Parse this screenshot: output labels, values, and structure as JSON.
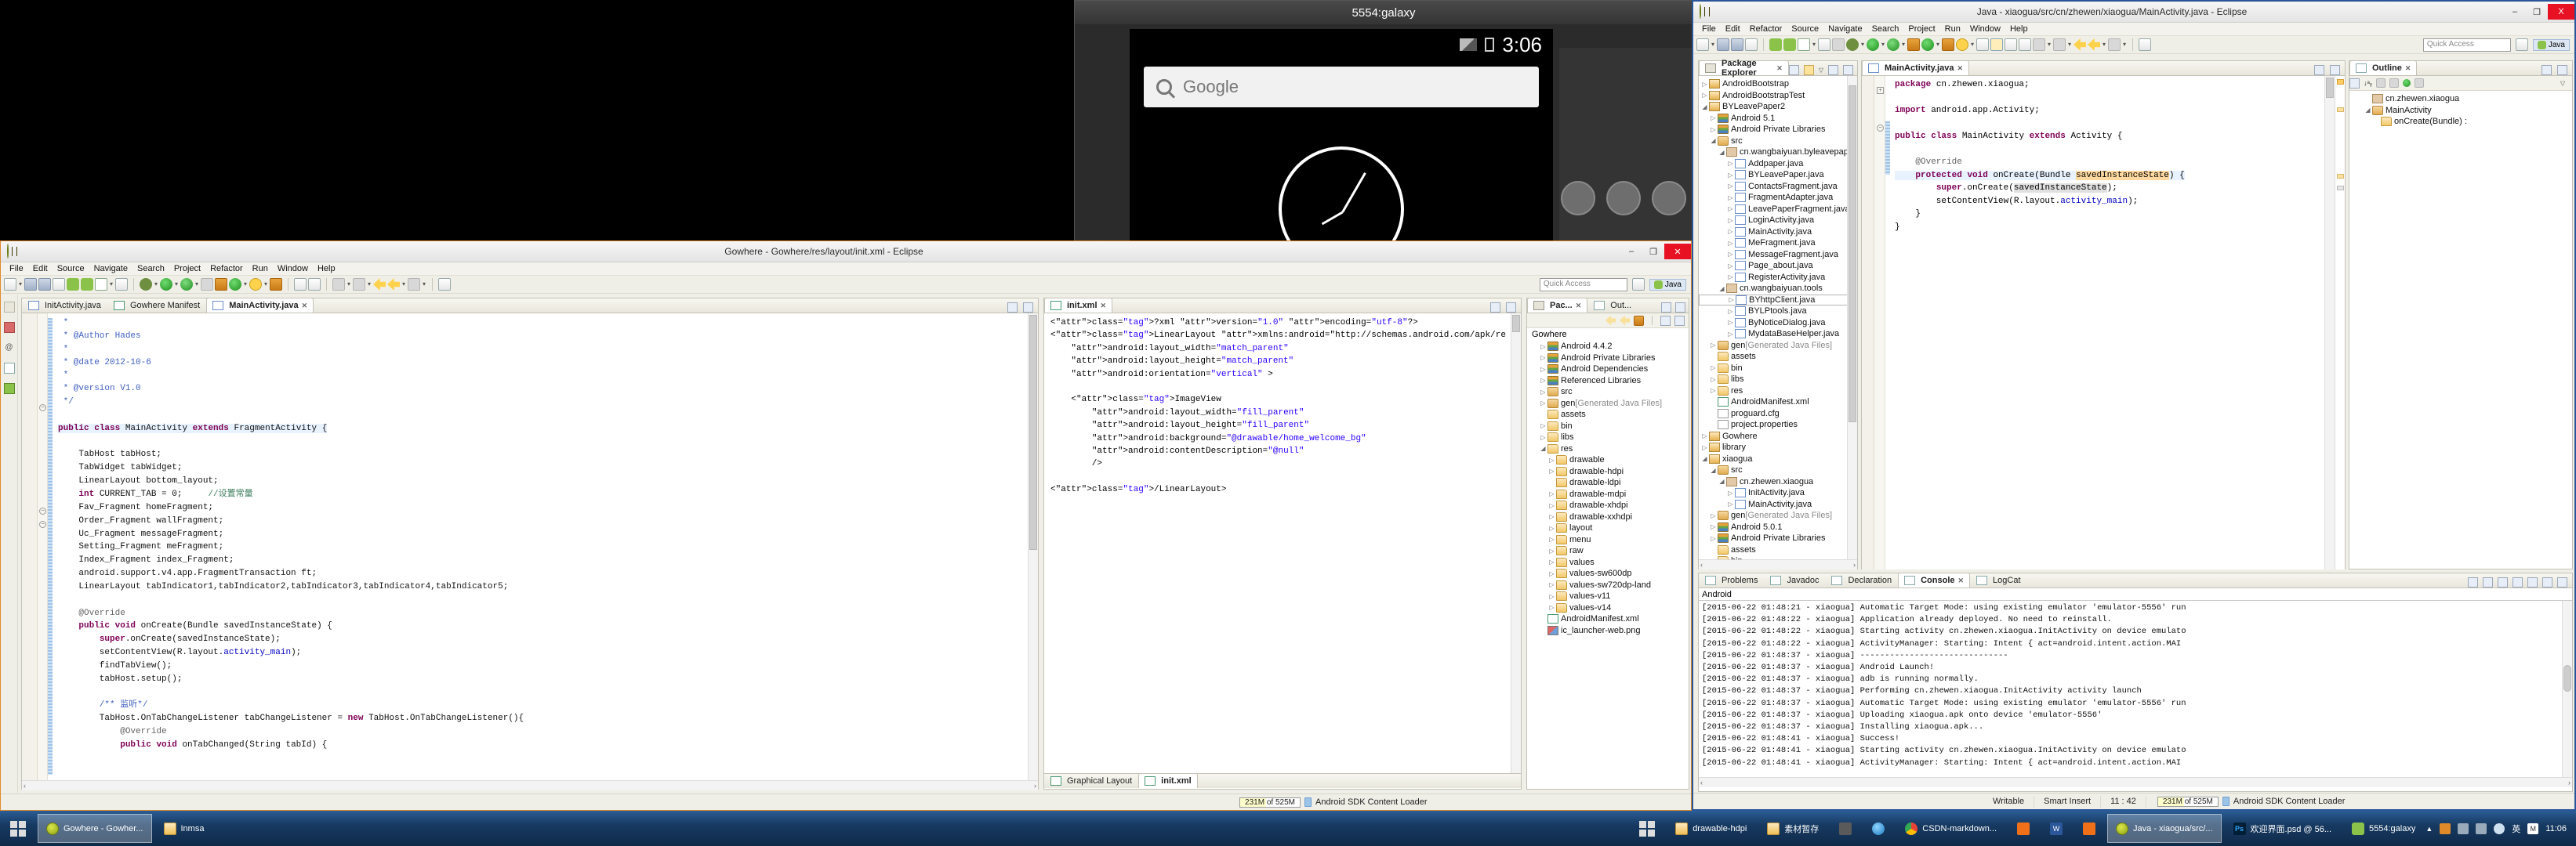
{
  "emulator": {
    "title": "5554:galaxy",
    "status_time": "3:06",
    "search_placeholder": "Google"
  },
  "left_eclipse": {
    "title": "Gowhere - Gowhere/res/layout/init.xml - Eclipse",
    "menu": [
      "File",
      "Edit",
      "Source",
      "Navigate",
      "Search",
      "Project",
      "Refactor",
      "Run",
      "Window",
      "Help"
    ],
    "quick_access": "Quick Access",
    "perspective": "Java",
    "editor_tabs": [
      {
        "label": "InitActivity.java",
        "active": false,
        "icon": "java-file-icon"
      },
      {
        "label": "Gowhere Manifest",
        "active": false,
        "icon": "xml-file-icon"
      },
      {
        "label": "MainActivity.java",
        "active": true,
        "icon": "java-warning-file-icon"
      }
    ],
    "java_code": [
      " *",
      " * @Author Hades",
      " *",
      " * @date 2012-10-6",
      " *",
      " * @version V1.0",
      " */",
      "",
      "public class MainActivity extends FragmentActivity {",
      "",
      "    TabHost tabHost;",
      "    TabWidget tabWidget;",
      "    LinearLayout bottom_layout;",
      "    int CURRENT_TAB = 0;     //设置常量",
      "    Fav_Fragment homeFragment;",
      "    Order_Fragment wallFragment;",
      "    Uc_Fragment messageFragment;",
      "    Setting_Fragment meFragment;",
      "    Index_Fragment index_Fragment;",
      "    android.support.v4.app.FragmentTransaction ft;",
      "    LinearLayout tabIndicator1,tabIndicator2,tabIndicator3,tabIndicator4,tabIndicator5;",
      "",
      "    @Override",
      "    public void onCreate(Bundle savedInstanceState) {",
      "        super.onCreate(savedInstanceState);",
      "        setContentView(R.layout.activity_main);",
      "        findTabView();",
      "        tabHost.setup();",
      "",
      "        /** 监听*/",
      "        TabHost.OnTabChangeListener tabChangeListener = new TabHost.OnTabChangeListener(){",
      "            @Override",
      "            public void onTabChanged(String tabId) {"
    ],
    "xml_tab": {
      "label": "init.xml",
      "icon": "xml-file-icon"
    },
    "xml_code": [
      "<?xml version=\"1.0\" encoding=\"utf-8\"?>",
      "<LinearLayout xmlns:android=\"http://schemas.android.com/apk/re",
      "    android:layout_width=\"match_parent\"",
      "    android:layout_height=\"match_parent\"",
      "    android:orientation=\"vertical\" >",
      "",
      "    <ImageView",
      "        android:layout_width=\"fill_parent\"",
      "        android:layout_height=\"fill_parent\"",
      "        android:background=\"@drawable/home_welcome_bg\"",
      "        android:contentDescription=\"@null\"",
      "        />",
      "",
      "</LinearLayout>"
    ],
    "xml_bottom_tabs": [
      "Graphical Layout",
      "init.xml"
    ],
    "explorer": {
      "tabs": [
        "Pac...",
        "Out..."
      ],
      "root": "Gowhere",
      "nodes": [
        {
          "label": "Android 4.4.2",
          "indent": 1,
          "twist": "closed",
          "icon": "library-icon"
        },
        {
          "label": "Android Private Libraries",
          "indent": 1,
          "twist": "closed",
          "icon": "library-icon"
        },
        {
          "label": "Android Dependencies",
          "indent": 1,
          "twist": "closed",
          "icon": "library-icon"
        },
        {
          "label": "Referenced Libraries",
          "indent": 1,
          "twist": "closed",
          "icon": "library-icon"
        },
        {
          "label": "src",
          "indent": 1,
          "twist": "closed",
          "icon": "source-folder-icon"
        },
        {
          "label": "gen [Generated Java Files]",
          "indent": 1,
          "twist": "closed",
          "icon": "source-folder-icon"
        },
        {
          "label": "assets",
          "indent": 1,
          "twist": "none",
          "icon": "folder-icon"
        },
        {
          "label": "bin",
          "indent": 1,
          "twist": "closed",
          "icon": "folder-icon"
        },
        {
          "label": "libs",
          "indent": 1,
          "twist": "closed",
          "icon": "folder-icon"
        },
        {
          "label": "res",
          "indent": 1,
          "twist": "open",
          "icon": "folder-icon"
        },
        {
          "label": "drawable",
          "indent": 2,
          "twist": "closed",
          "icon": "folder-icon"
        },
        {
          "label": "drawable-hdpi",
          "indent": 2,
          "twist": "closed",
          "icon": "folder-icon"
        },
        {
          "label": "drawable-ldpi",
          "indent": 2,
          "twist": "none",
          "icon": "folder-icon"
        },
        {
          "label": "drawable-mdpi",
          "indent": 2,
          "twist": "closed",
          "icon": "folder-icon"
        },
        {
          "label": "drawable-xhdpi",
          "indent": 2,
          "twist": "closed",
          "icon": "folder-icon"
        },
        {
          "label": "drawable-xxhdpi",
          "indent": 2,
          "twist": "closed",
          "icon": "folder-icon"
        },
        {
          "label": "layout",
          "indent": 2,
          "twist": "closed",
          "icon": "folder-icon"
        },
        {
          "label": "menu",
          "indent": 2,
          "twist": "closed",
          "icon": "folder-icon"
        },
        {
          "label": "raw",
          "indent": 2,
          "twist": "closed",
          "icon": "folder-icon"
        },
        {
          "label": "values",
          "indent": 2,
          "twist": "closed",
          "icon": "folder-icon"
        },
        {
          "label": "values-sw600dp",
          "indent": 2,
          "twist": "closed",
          "icon": "folder-icon"
        },
        {
          "label": "values-sw720dp-land",
          "indent": 2,
          "twist": "closed",
          "icon": "folder-icon"
        },
        {
          "label": "values-v11",
          "indent": 2,
          "twist": "closed",
          "icon": "folder-icon"
        },
        {
          "label": "values-v14",
          "indent": 2,
          "twist": "closed",
          "icon": "folder-icon"
        },
        {
          "label": "AndroidManifest.xml",
          "indent": 1,
          "twist": "none",
          "icon": "manifest-icon"
        },
        {
          "label": "ic_launcher-web.png",
          "indent": 1,
          "twist": "none",
          "icon": "image-file-icon"
        }
      ]
    },
    "status": {
      "memory": "231M of 525M",
      "job": "Android SDK Content Loader"
    }
  },
  "right_eclipse": {
    "title": "Java - xiaogua/src/cn/zhewen/xiaogua/MainActivity.java - Eclipse",
    "menu": [
      "File",
      "Edit",
      "Refactor",
      "Source",
      "Navigate",
      "Search",
      "Project",
      "Run",
      "Window",
      "Help"
    ],
    "quick_access": "Quick Access",
    "perspective": "Java",
    "explorer": {
      "tab": "Package Explorer",
      "nodes": [
        {
          "label": "AndroidBootstrap",
          "indent": 0,
          "twist": "closed",
          "icon": "android-project-icon"
        },
        {
          "label": "AndroidBootstrapTest",
          "indent": 0,
          "twist": "closed",
          "icon": "android-project-icon"
        },
        {
          "label": "BYLeavePaper2",
          "indent": 0,
          "twist": "open",
          "icon": "android-project-error-icon"
        },
        {
          "label": "Android 5.1",
          "indent": 1,
          "twist": "closed",
          "icon": "library-icon"
        },
        {
          "label": "Android Private Libraries",
          "indent": 1,
          "twist": "closed",
          "icon": "library-icon"
        },
        {
          "label": "src",
          "indent": 1,
          "twist": "open",
          "icon": "source-folder-icon"
        },
        {
          "label": "cn.wangbaiyuan.byleavepaper",
          "indent": 2,
          "twist": "open",
          "icon": "package-icon"
        },
        {
          "label": "Addpaper.java",
          "indent": 3,
          "twist": "closed",
          "icon": "java-file-icon"
        },
        {
          "label": "BYLeavePaper.java",
          "indent": 3,
          "twist": "closed",
          "icon": "java-file-icon"
        },
        {
          "label": "ContactsFragment.java",
          "indent": 3,
          "twist": "closed",
          "icon": "java-file-icon"
        },
        {
          "label": "FragmentAdapter.java",
          "indent": 3,
          "twist": "closed",
          "icon": "java-file-icon"
        },
        {
          "label": "LeavePaperFragment.java",
          "indent": 3,
          "twist": "closed",
          "icon": "java-file-icon"
        },
        {
          "label": "LoginActivity.java",
          "indent": 3,
          "twist": "closed",
          "icon": "java-file-icon"
        },
        {
          "label": "MainActivity.java",
          "indent": 3,
          "twist": "closed",
          "icon": "java-file-icon"
        },
        {
          "label": "MeFragment.java",
          "indent": 3,
          "twist": "closed",
          "icon": "java-file-icon"
        },
        {
          "label": "MessageFragment.java",
          "indent": 3,
          "twist": "closed",
          "icon": "java-file-icon"
        },
        {
          "label": "Page_about.java",
          "indent": 3,
          "twist": "closed",
          "icon": "java-file-icon"
        },
        {
          "label": "RegisterActivity.java",
          "indent": 3,
          "twist": "closed",
          "icon": "java-file-icon"
        },
        {
          "label": "cn.wangbaiyuan.tools",
          "indent": 2,
          "twist": "open",
          "icon": "package-icon"
        },
        {
          "label": "BYhttpClient.java",
          "indent": 3,
          "twist": "closed",
          "icon": "java-file-icon",
          "selected": true
        },
        {
          "label": "BYLPtools.java",
          "indent": 3,
          "twist": "closed",
          "icon": "java-file-icon"
        },
        {
          "label": "ByNoticeDialog.java",
          "indent": 3,
          "twist": "closed",
          "icon": "java-file-icon"
        },
        {
          "label": "MydataBaseHelper.java",
          "indent": 3,
          "twist": "closed",
          "icon": "java-file-icon"
        },
        {
          "label": "gen [Generated Java Files]",
          "indent": 1,
          "twist": "closed",
          "icon": "source-folder-icon"
        },
        {
          "label": "assets",
          "indent": 1,
          "twist": "none",
          "icon": "folder-icon"
        },
        {
          "label": "bin",
          "indent": 1,
          "twist": "closed",
          "icon": "folder-icon"
        },
        {
          "label": "libs",
          "indent": 1,
          "twist": "closed",
          "icon": "folder-icon"
        },
        {
          "label": "res",
          "indent": 1,
          "twist": "closed",
          "icon": "folder-icon"
        },
        {
          "label": "AndroidManifest.xml",
          "indent": 1,
          "twist": "none",
          "icon": "manifest-icon"
        },
        {
          "label": "proguard.cfg",
          "indent": 1,
          "twist": "none",
          "icon": "file-icon"
        },
        {
          "label": "project.properties",
          "indent": 1,
          "twist": "none",
          "icon": "file-icon"
        },
        {
          "label": "Gowhere",
          "indent": 0,
          "twist": "closed",
          "icon": "android-project-icon"
        },
        {
          "label": "library",
          "indent": 0,
          "twist": "closed",
          "icon": "android-project-icon"
        },
        {
          "label": "xiaogua",
          "indent": 0,
          "twist": "open",
          "icon": "android-project-icon"
        },
        {
          "label": "src",
          "indent": 1,
          "twist": "open",
          "icon": "source-folder-icon"
        },
        {
          "label": "cn.zhewen.xiaogua",
          "indent": 2,
          "twist": "open",
          "icon": "package-icon"
        },
        {
          "label": "InitActivity.java",
          "indent": 3,
          "twist": "closed",
          "icon": "java-file-icon"
        },
        {
          "label": "MainActivity.java",
          "indent": 3,
          "twist": "closed",
          "icon": "java-warning-file-icon"
        },
        {
          "label": "gen [Generated Java Files]",
          "indent": 1,
          "twist": "closed",
          "icon": "source-folder-icon"
        },
        {
          "label": "Android 5.0.1",
          "indent": 1,
          "twist": "closed",
          "icon": "library-icon"
        },
        {
          "label": "Android Private Libraries",
          "indent": 1,
          "twist": "closed",
          "icon": "library-icon"
        },
        {
          "label": "assets",
          "indent": 1,
          "twist": "none",
          "icon": "folder-icon"
        },
        {
          "label": "bin",
          "indent": 1,
          "twist": "closed",
          "icon": "folder-icon"
        }
      ]
    },
    "editor_tab": {
      "label": "MainActivity.java",
      "icon": "java-warning-file-icon"
    },
    "java_code": [
      "package cn.zhewen.xiaogua;",
      "",
      "import android.app.Activity;",
      "",
      "public class MainActivity extends Activity {",
      "",
      "    @Override",
      "    protected void onCreate(Bundle savedInstanceState) {",
      "        super.onCreate(savedInstanceState);",
      "        setContentView(R.layout.activity_main);",
      "    }",
      "}"
    ],
    "outline": {
      "tab": "Outline",
      "nodes": [
        {
          "label": "cn.zhewen.xiaogua",
          "indent": 0,
          "icon": "package-icon",
          "twist": "none"
        },
        {
          "label": "MainActivity",
          "indent": 0,
          "icon": "class-icon",
          "twist": "open"
        },
        {
          "label": "onCreate(Bundle) :",
          "indent": 1,
          "icon": "method-icon",
          "twist": "none"
        }
      ]
    },
    "bottom_tabs": [
      {
        "label": "Problems",
        "icon": "problems-icon",
        "active": false
      },
      {
        "label": "Javadoc",
        "icon": "javadoc-icon",
        "active": false
      },
      {
        "label": "Declaration",
        "icon": "declaration-icon",
        "active": false
      },
      {
        "label": "Console",
        "icon": "console-icon",
        "active": true
      },
      {
        "label": "LogCat",
        "icon": "logcat-icon",
        "active": false
      }
    ],
    "console_title": "Android",
    "console_lines": [
      "[2015-06-22 01:48:21 - xiaogua] Automatic Target Mode: using existing emulator 'emulator-5556' run",
      "[2015-06-22 01:48:22 - xiaogua] Application already deployed. No need to reinstall.",
      "[2015-06-22 01:48:22 - xiaogua] Starting activity cn.zhewen.xiaogua.InitActivity on device emulato",
      "[2015-06-22 01:48:22 - xiaogua] ActivityManager: Starting: Intent { act=android.intent.action.MAI",
      "[2015-06-22 01:48:37 - xiaogua] ------------------------------",
      "[2015-06-22 01:48:37 - xiaogua] Android Launch!",
      "[2015-06-22 01:48:37 - xiaogua] adb is running normally.",
      "[2015-06-22 01:48:37 - xiaogua] Performing cn.zhewen.xiaogua.InitActivity activity launch",
      "[2015-06-22 01:48:37 - xiaogua] Automatic Target Mode: using existing emulator 'emulator-5556' run",
      "[2015-06-22 01:48:37 - xiaogua] Uploading xiaogua.apk onto device 'emulator-5556'",
      "[2015-06-22 01:48:37 - xiaogua] Installing xiaogua.apk...",
      "[2015-06-22 01:48:41 - xiaogua] Success!",
      "[2015-06-22 01:48:41 - xiaogua] Starting activity cn.zhewen.xiaogua.InitActivity on device emulato",
      "[2015-06-22 01:48:41 - xiaogua] ActivityManager: Starting: Intent { act=android.intent.action.MAI"
    ],
    "status": {
      "writable": "Writable",
      "insert_mode": "Smart Insert",
      "cursor": "11 : 42",
      "memory": "231M of 525M",
      "job": "Android SDK Content Loader"
    },
    "window_buttons": {
      "minimize": "–",
      "maximize": "❐",
      "close": "X"
    }
  },
  "taskbar": {
    "left_items": [
      {
        "label": "Gowhere - Gowher...",
        "icon": "eclipse-icon",
        "active": true
      },
      {
        "label": "Inmsa",
        "icon": "folder-icon",
        "active": false
      }
    ],
    "right_items": [
      {
        "label": "drawable-hdpi",
        "icon": "folder-icon",
        "active": false
      },
      {
        "label": "素材暂存",
        "icon": "folder-icon",
        "active": false
      },
      {
        "label": "",
        "icon": "grey-icon",
        "active": false
      },
      {
        "label": "",
        "icon": "ie-icon",
        "active": false
      },
      {
        "label": "CSDN-markdown...",
        "icon": "chrome-icon",
        "active": false
      },
      {
        "label": "",
        "icon": "firefox-icon",
        "active": false
      },
      {
        "label": "",
        "icon": "word-icon",
        "active": false
      },
      {
        "label": "",
        "icon": "orange-icon",
        "active": false
      },
      {
        "label": "Java - xiaogua/src/...",
        "icon": "eclipse-icon",
        "active": true
      },
      {
        "label": "欢迎界面.psd @ 56...",
        "icon": "photoshop-icon",
        "active": false
      },
      {
        "label": "5554:galaxy",
        "icon": "android-icon",
        "active": false
      }
    ],
    "tray": {
      "ime": "英",
      "clock": "11:06"
    }
  }
}
